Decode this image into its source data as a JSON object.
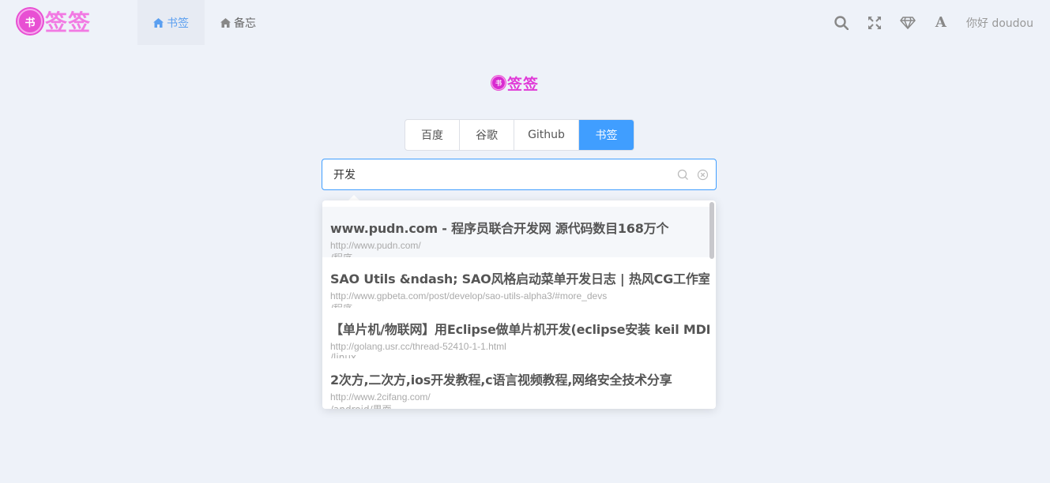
{
  "header": {
    "logo_badge": "书",
    "logo_text": "签签",
    "nav": [
      {
        "label": "书签",
        "icon": "home-icon",
        "active": true
      },
      {
        "label": "备忘",
        "icon": "home-icon",
        "active": false
      }
    ],
    "icons": [
      "search-icon",
      "fullscreen-icon",
      "diamond-icon",
      "font-icon"
    ],
    "font_icon_glyph": "A",
    "greeting": "你好 doudou"
  },
  "center_logo": {
    "badge": "书",
    "text": "签签"
  },
  "engines": [
    {
      "label": "百度",
      "active": false
    },
    {
      "label": "谷歌",
      "active": false
    },
    {
      "label": "Github",
      "active": false
    },
    {
      "label": "书签",
      "active": true
    }
  ],
  "search": {
    "value": "开发",
    "placeholder": ""
  },
  "suggestions": [
    {
      "title": "www.pudn.com - 程序员联合开发网 源代码数目168万个",
      "url": "http://www.pudn.com/",
      "path": "/程序"
    },
    {
      "title": "SAO Utils &ndash; SAO风格启动菜单开发日志 | 热风CG工作室",
      "url": "http://www.gpbeta.com/post/develop/sao-utils-alpha3/#more_devs",
      "path": "/程序"
    },
    {
      "title": "【单片机/物联网】用Eclipse做单片机开发(eclipse安装 keil MDK图解",
      "url": "http://golang.usr.cc/thread-52410-1-1.html",
      "path": "/linux"
    },
    {
      "title": "2次方,二次方,ios开发教程,c语言视频教程,网络安全技术分享",
      "url": "http://www.2cifang.com/",
      "path": "/android/界面"
    }
  ],
  "colors": {
    "accent": "#409eff",
    "logo": "#f27ae3",
    "background": "#eef2f9"
  }
}
